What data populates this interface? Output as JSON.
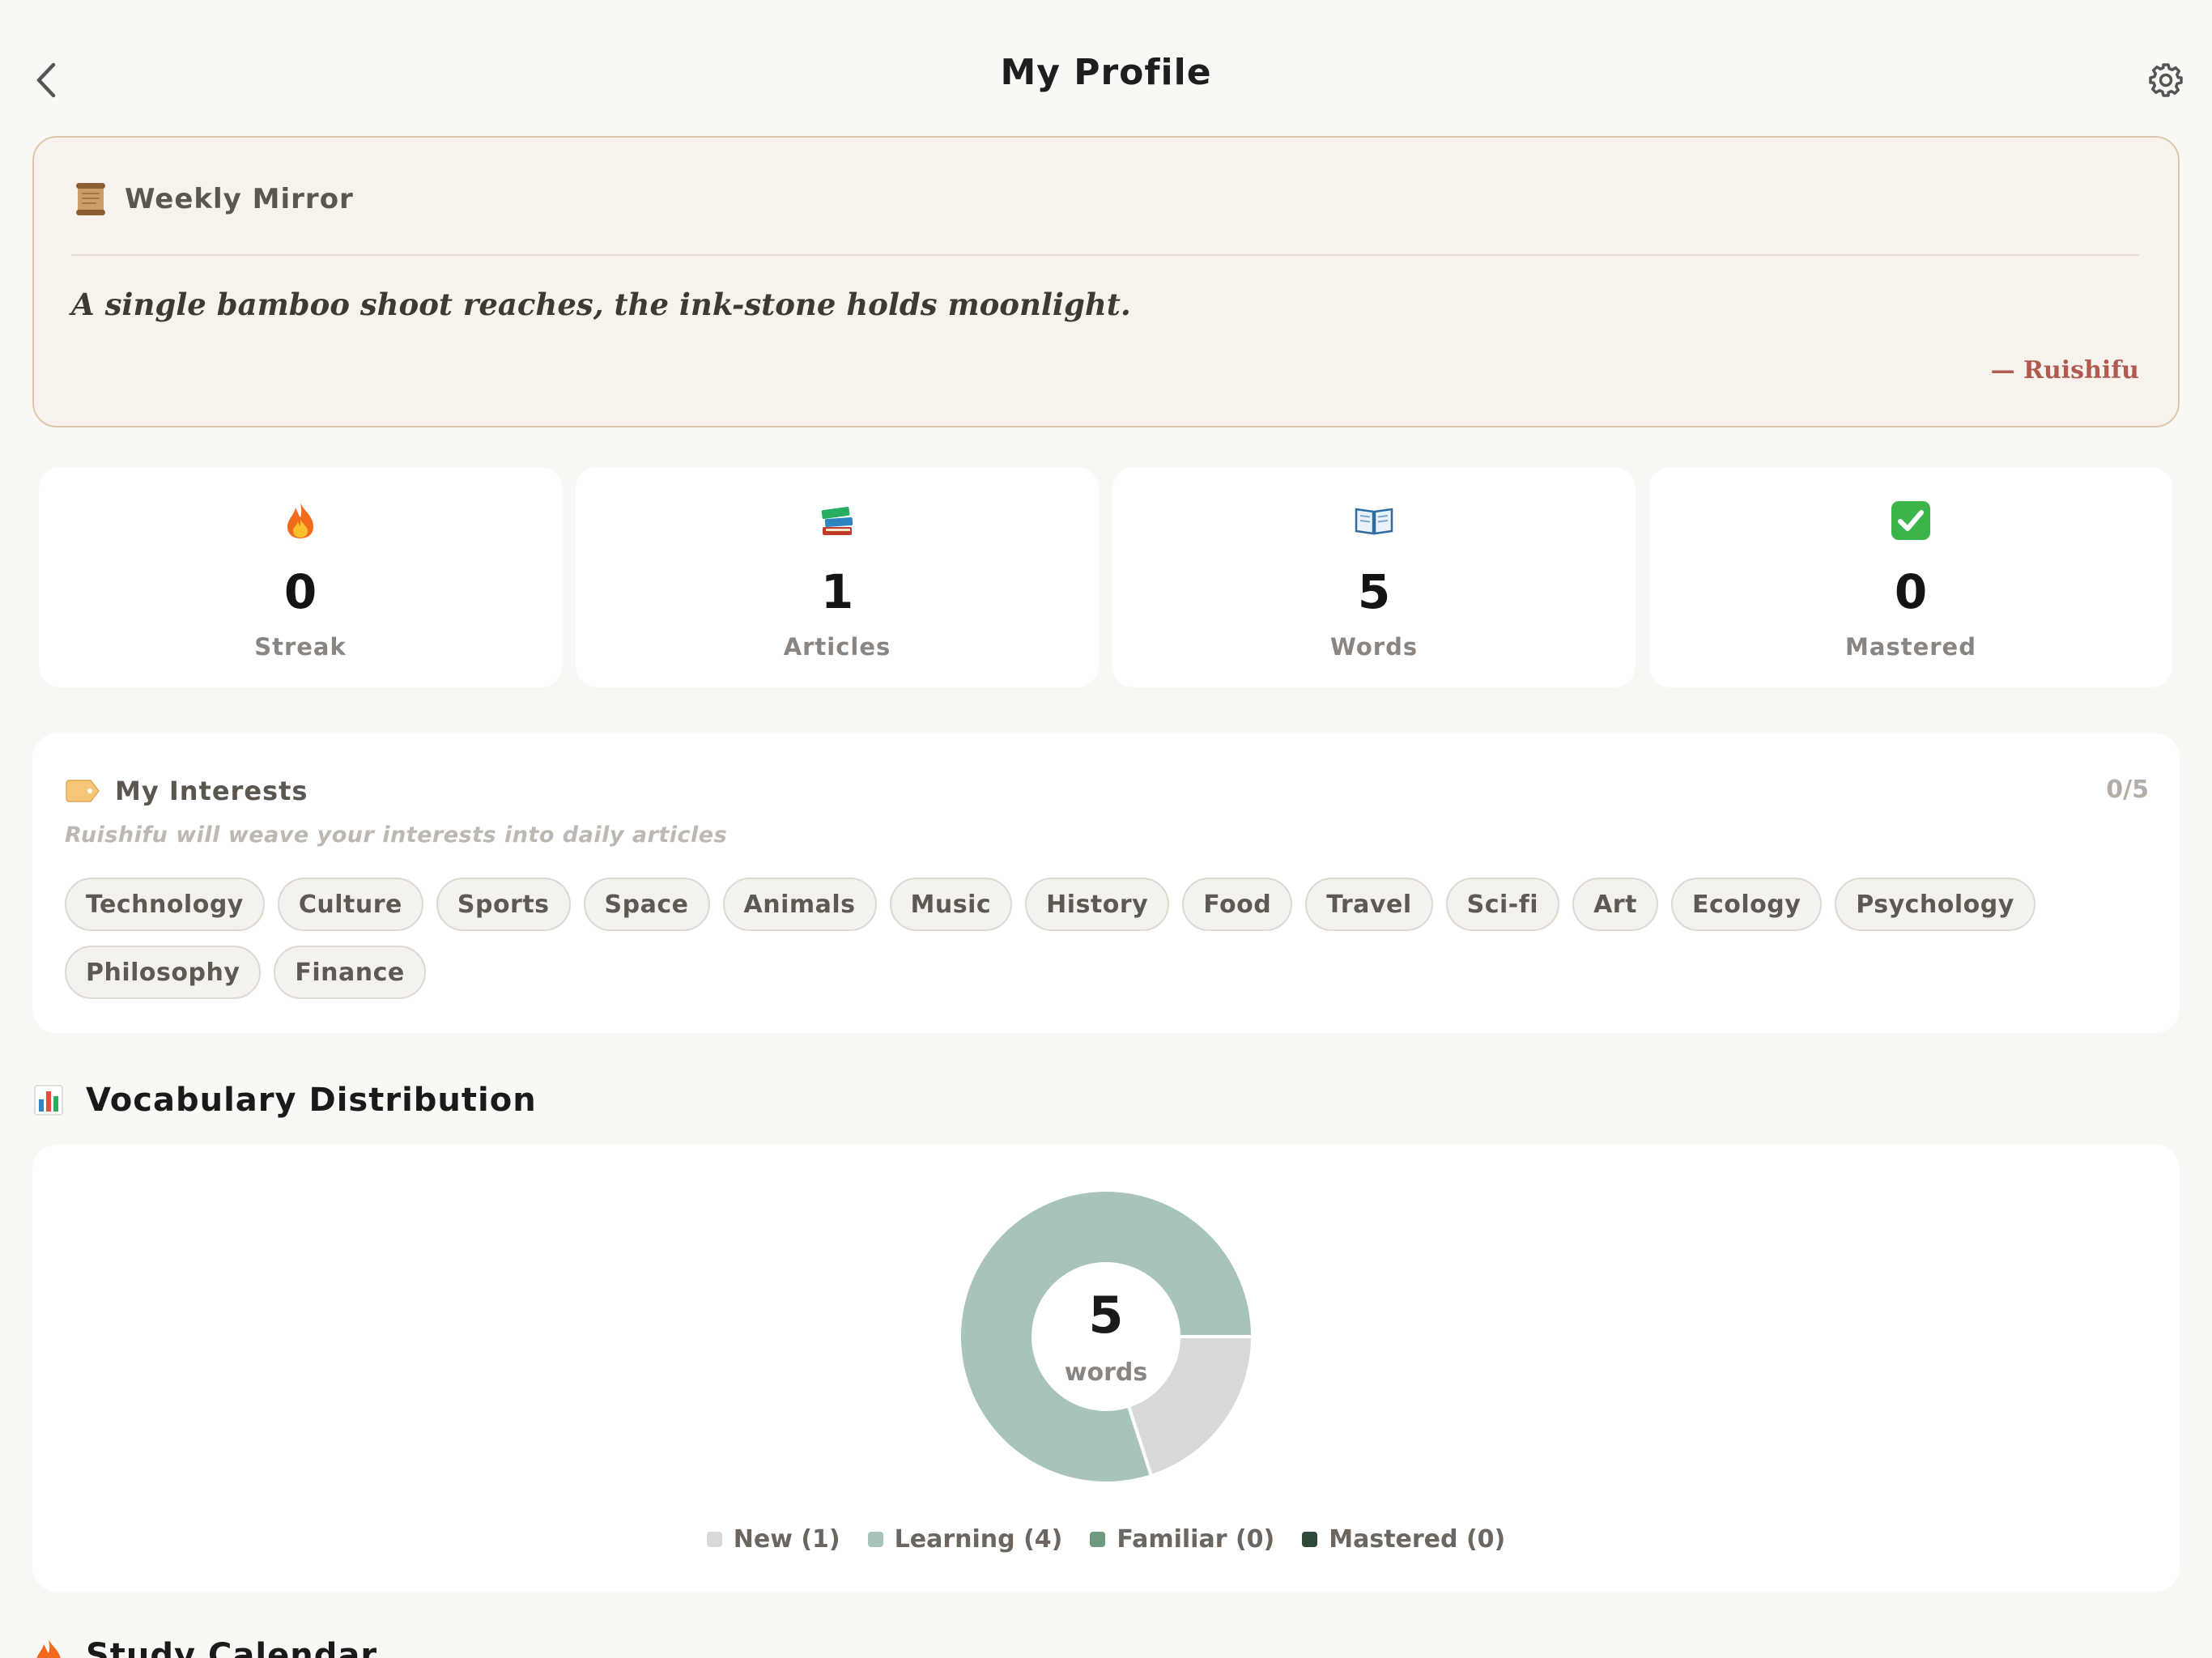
{
  "header": {
    "title": "My Profile"
  },
  "weekly_mirror": {
    "title": "Weekly Mirror",
    "quote": "A single bamboo shoot reaches, the ink-stone holds moonlight.",
    "author": "— Ruishifu"
  },
  "stats": [
    {
      "icon": "fire-icon",
      "value": "0",
      "label": "Streak"
    },
    {
      "icon": "books-icon",
      "value": "1",
      "label": "Articles"
    },
    {
      "icon": "open-book-icon",
      "value": "5",
      "label": "Words"
    },
    {
      "icon": "check-icon",
      "value": "0",
      "label": "Mastered"
    }
  ],
  "interests": {
    "title": "My Interests",
    "count": "0/5",
    "subtitle": "Ruishifu will weave your interests into daily articles",
    "tags": [
      "Technology",
      "Culture",
      "Sports",
      "Space",
      "Animals",
      "Music",
      "History",
      "Food",
      "Travel",
      "Sci-fi",
      "Art",
      "Ecology",
      "Psychology",
      "Philosophy",
      "Finance"
    ]
  },
  "vocabulary": {
    "title": "Vocabulary Distribution",
    "total": "5",
    "unit": "words",
    "legend": [
      {
        "label": "New (1)",
        "color": "#d9d9d9"
      },
      {
        "label": "Learning (4)",
        "color": "#a8c4b8"
      },
      {
        "label": "Familiar (0)",
        "color": "#6e9a80"
      },
      {
        "label": "Mastered (0)",
        "color": "#2f4a38"
      }
    ]
  },
  "chart_data": {
    "type": "pie",
    "categories": [
      "New",
      "Learning",
      "Familiar",
      "Mastered"
    ],
    "values": [
      1,
      4,
      0,
      0
    ],
    "colors": [
      "#d9d9d9",
      "#a8c4b8",
      "#6e9a80",
      "#2f4a38"
    ]
  },
  "calendar": {
    "title": "Study Calendar"
  }
}
